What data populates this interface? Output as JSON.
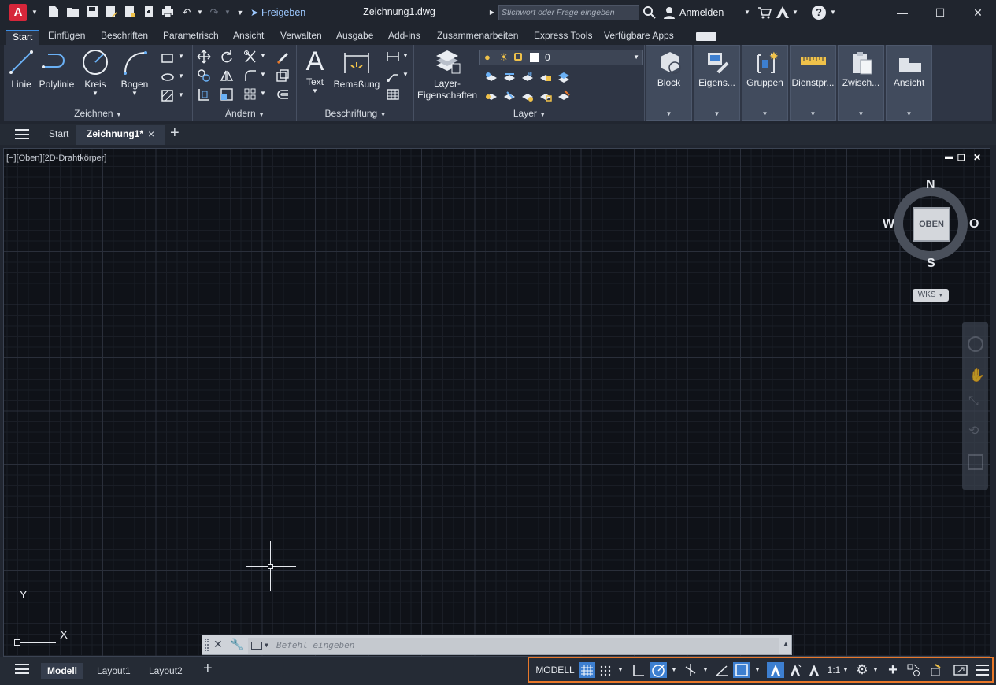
{
  "titlebar": {
    "app_logo": "A",
    "share_label": "Freigeben",
    "document_title": "Zeichnung1.dwg",
    "search_placeholder": "Stichwort oder Frage eingeben",
    "login_label": "Anmelden",
    "help_glyph": "?"
  },
  "ribbon_tabs": [
    "Start",
    "Einfügen",
    "Beschriften",
    "Parametrisch",
    "Ansicht",
    "Verwalten",
    "Ausgabe",
    "Add-ins",
    "Zusammenarbeiten",
    "Express Tools",
    "Verfügbare Apps"
  ],
  "draw_panel": {
    "title": "Zeichnen",
    "tools": [
      "Linie",
      "Polylinie",
      "Kreis",
      "Bogen"
    ]
  },
  "modify_panel": {
    "title": "Ändern"
  },
  "annotation_panel": {
    "title": "Beschriftung",
    "text_label": "Text",
    "dimension_label": "Bemaßung"
  },
  "layer_panel": {
    "title": "Layer",
    "properties_label_1": "Layer-",
    "properties_label_2": "Eigenschaften",
    "current_layer": "0"
  },
  "big_panels": [
    "Block",
    "Eigens...",
    "Gruppen",
    "Dienstpr...",
    "Zwisch...",
    "Ansicht"
  ],
  "file_tabs": {
    "start": "Start",
    "current": "Zeichnung1*",
    "close_glyph": "×",
    "add_glyph": "+"
  },
  "viewport": {
    "label": "[−][Oben][2D-Drahtkörper]"
  },
  "viewcube": {
    "north": "N",
    "south": "S",
    "east": "O",
    "west": "W",
    "face": "OBEN",
    "ucs": "WKS"
  },
  "ucs_icon": {
    "x": "X",
    "y": "Y"
  },
  "command_line": {
    "placeholder": "Befehl eingeben"
  },
  "layout_tabs": [
    "Modell",
    "Layout1",
    "Layout2"
  ],
  "status_bar": {
    "model_label": "MODELL",
    "scale": "1:1"
  },
  "colors": {
    "accent": "#3d7fd0",
    "highlight_border": "#e8782a",
    "logo": "#d6263a"
  }
}
